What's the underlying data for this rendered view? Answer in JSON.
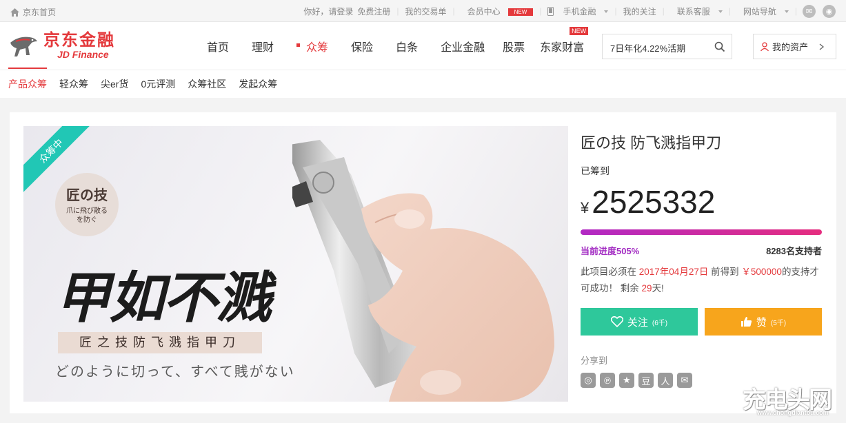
{
  "topbar": {
    "home": "京东首页",
    "greeting": "你好，请登录",
    "register": "免费注册",
    "orders": "我的交易单",
    "member": "会员中心",
    "member_badge": "NEW",
    "mobile": "手机金融",
    "follow": "我的关注",
    "service": "联系客服",
    "sitenav": "网站导航",
    "social_icons": [
      "wechat-icon",
      "weibo-icon"
    ]
  },
  "header": {
    "logo_cn": "京东金融",
    "logo_en": "JD Finance",
    "nav": [
      {
        "label": "首页"
      },
      {
        "label": "理财"
      },
      {
        "label": "众筹"
      },
      {
        "label": "保险"
      },
      {
        "label": "白条"
      },
      {
        "label": "企业金融"
      },
      {
        "label": "股票"
      },
      {
        "label": "东家财富",
        "badge": "NEW"
      }
    ],
    "active_nav": "众筹",
    "search_text": "7日年化4.22%活期",
    "my_assets": "我的资产"
  },
  "subnav": {
    "items": [
      "产品众筹",
      "轻众筹",
      "尖er货",
      "0元评测",
      "众筹社区",
      "发起众筹"
    ],
    "active": "产品众筹"
  },
  "product": {
    "ribbon": "众筹中",
    "banner": {
      "seal_title": "匠の技",
      "seal_sub": "爪に飛び散る\nを防ぐ",
      "calligraphy": "甲如不溅",
      "tagline": "匠之技防飞溅指甲刀",
      "jp_line": "どのように切って、すべて賎がない"
    },
    "title": "匠の技 防飞溅指甲刀",
    "raised_label": "已筹到",
    "currency": "¥",
    "amount": "2525332",
    "progress_label": "当前进度505%",
    "progress_percent": 505,
    "supporters": "8283名支持者",
    "desc_pre": "此项目必须在",
    "deadline": "2017年04月27日",
    "desc_mid": "前得到",
    "goal": "￥500000",
    "desc_post": "的支持才可成功！ 剩余",
    "days_left": "29",
    "days_unit": "天!",
    "follow_label": "关注",
    "follow_count": "(6千)",
    "like_label": "赞",
    "like_count": "(5千)",
    "share_label": "分享到",
    "share_icons": [
      "weibo-icon",
      "qq-weibo-icon",
      "qzone-icon",
      "douban-icon",
      "renren-icon",
      "wechat-icon"
    ]
  },
  "watermark": {
    "text": "充电头网",
    "url": "www.chongdiantou.com"
  },
  "colors": {
    "brand": "#e4393c",
    "follow": "#2ec89b",
    "like": "#f7a51c",
    "progress": "#b129c4"
  }
}
